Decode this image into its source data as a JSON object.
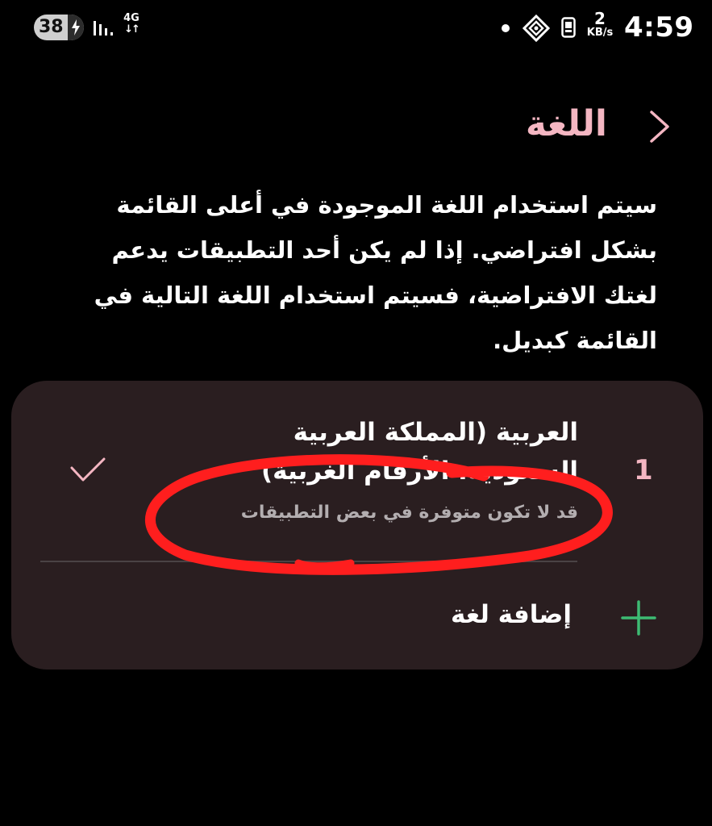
{
  "status_bar": {
    "battery_level": "38",
    "network_type": "4G",
    "network_arrows": "↓↑",
    "speed_value": "2",
    "speed_unit": "KB/s",
    "time": "4:59"
  },
  "header": {
    "title": "اللغة"
  },
  "description": "سيتم استخدام اللغة الموجودة في أعلى القائمة بشكل افتراضي. إذا لم يكن أحد التطبيقات يدعم لغتك الافتراضية، فسيتم استخدام اللغة التالية في القائمة كبديل.",
  "languages": [
    {
      "index": "1",
      "name": "العربية (المملكة العربية السعودية، الأرقام الغربية)",
      "note": "قد لا تكون متوفرة في بعض التطبيقات",
      "selected": true
    }
  ],
  "add_language": {
    "label": "إضافة لغة"
  },
  "colors": {
    "background": "#000000",
    "card": "#2a1e20",
    "accent_pink": "#f4b6c2",
    "plus_green": "#3dbb73",
    "annotation_red": "#ff1e1e",
    "note_gray": "#b3aeb0"
  },
  "icons": {
    "back": "chevron-right-icon",
    "check": "check-icon",
    "add": "plus-icon",
    "charging": "lightning-icon",
    "signal": "signal-icon",
    "vpn": "vpn-icon",
    "sim": "sim-icon",
    "notification": "dot-icon"
  }
}
